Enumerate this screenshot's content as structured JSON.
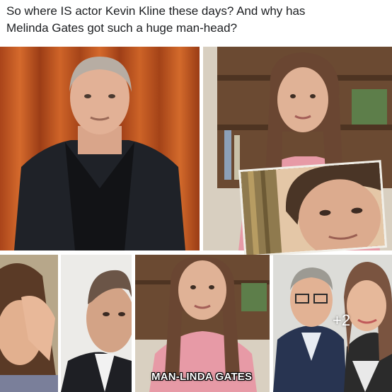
{
  "post": {
    "caption_line1": "So where IS actor Kevin Kline these days? And why has",
    "caption_line2": "Melinda Gates got such a huge man-head?"
  },
  "gallery": {
    "more_count": "+2",
    "overlay_caption": "MAN-LINDA GATES"
  },
  "colors": {
    "curtain": "#c0551e",
    "suit": "#1f2228",
    "sweater_pink": "#e79aa6",
    "bookshelf": "#6b4a32",
    "background_text": "#1c1e21"
  }
}
